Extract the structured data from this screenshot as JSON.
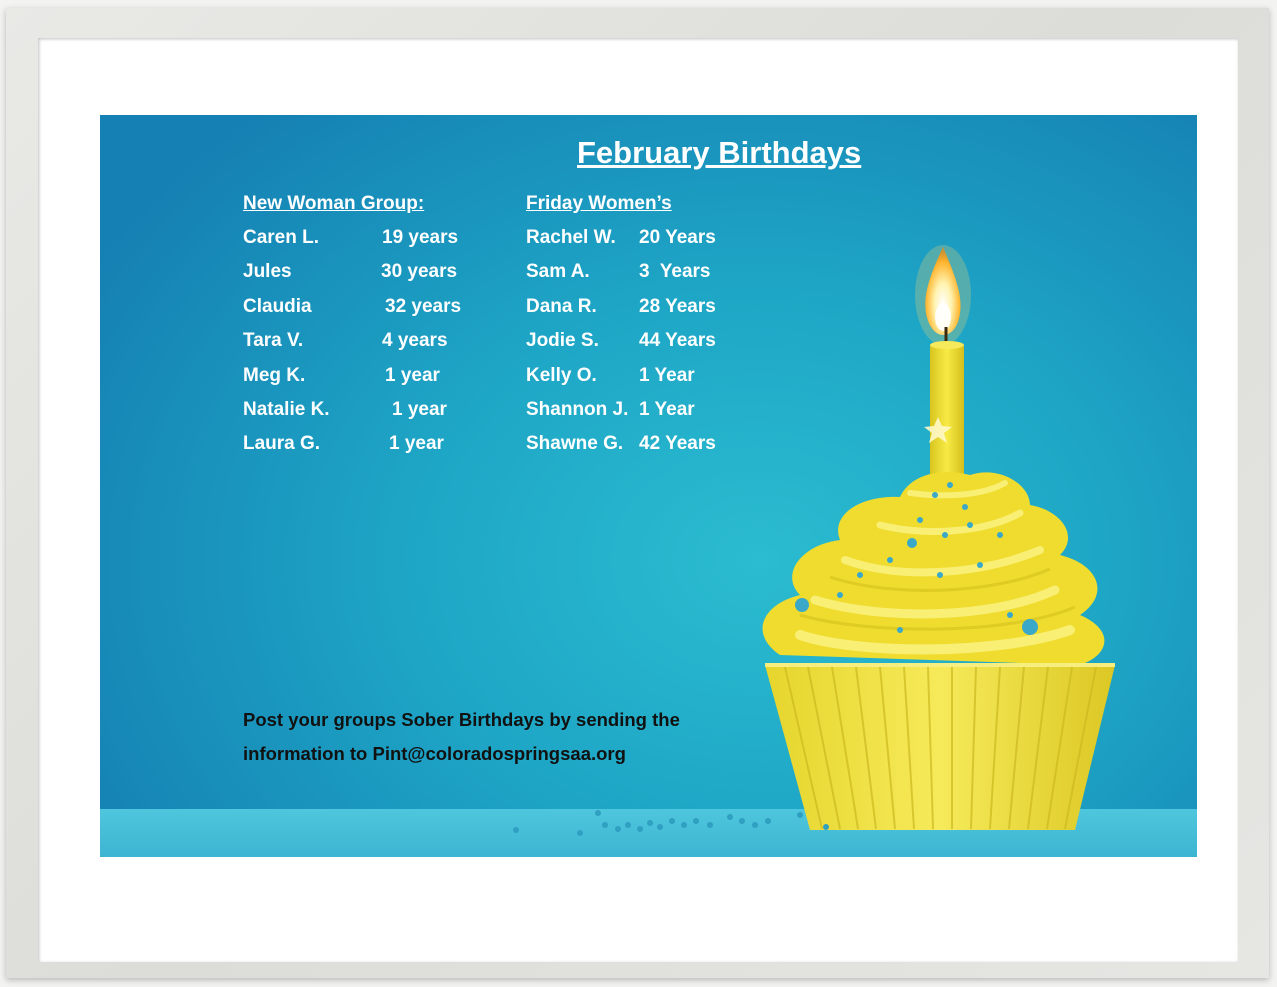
{
  "title": "February Birthdays",
  "groups": [
    {
      "heading": "New Woman Group:",
      "rows": [
        {
          "name": "Caren L.",
          "years": "19 years"
        },
        {
          "name": "Jules",
          "years": "30 years"
        },
        {
          "name": "Claudia",
          "years": "32 years"
        },
        {
          "name": "Tara V.",
          "years": "4 years"
        },
        {
          "name": "Meg K.",
          "years": "1 year"
        },
        {
          "name": "Natalie K.",
          "years": "1 year"
        },
        {
          "name": "Laura G.",
          "years": "1 year"
        }
      ]
    },
    {
      "heading": "Friday Women’s",
      "rows": [
        {
          "name": "Rachel W.",
          "years": "20 Years"
        },
        {
          "name": "Sam A.",
          "years": "3  Years"
        },
        {
          "name": "Dana R.",
          "years": "28 Years"
        },
        {
          "name": "Jodie S.",
          "years": "44 Years"
        },
        {
          "name": "Kelly O.",
          "years": "1 Year"
        },
        {
          "name": "Shannon J.",
          "years": "1 Year"
        },
        {
          "name": "Shawne G.",
          "years": "42 Years"
        }
      ]
    }
  ],
  "footer": {
    "line1": "Post your groups Sober Birthdays by sending the",
    "line2": "information to Pint@coloradospringsaa.org"
  },
  "colors": {
    "background_blue": "#1ea6c6",
    "frosting_yellow": "#f2e236",
    "text_white": "#ffffff",
    "footer_text": "#111111"
  },
  "icons": [
    "birthday-cupcake-icon",
    "candle-flame-icon"
  ]
}
